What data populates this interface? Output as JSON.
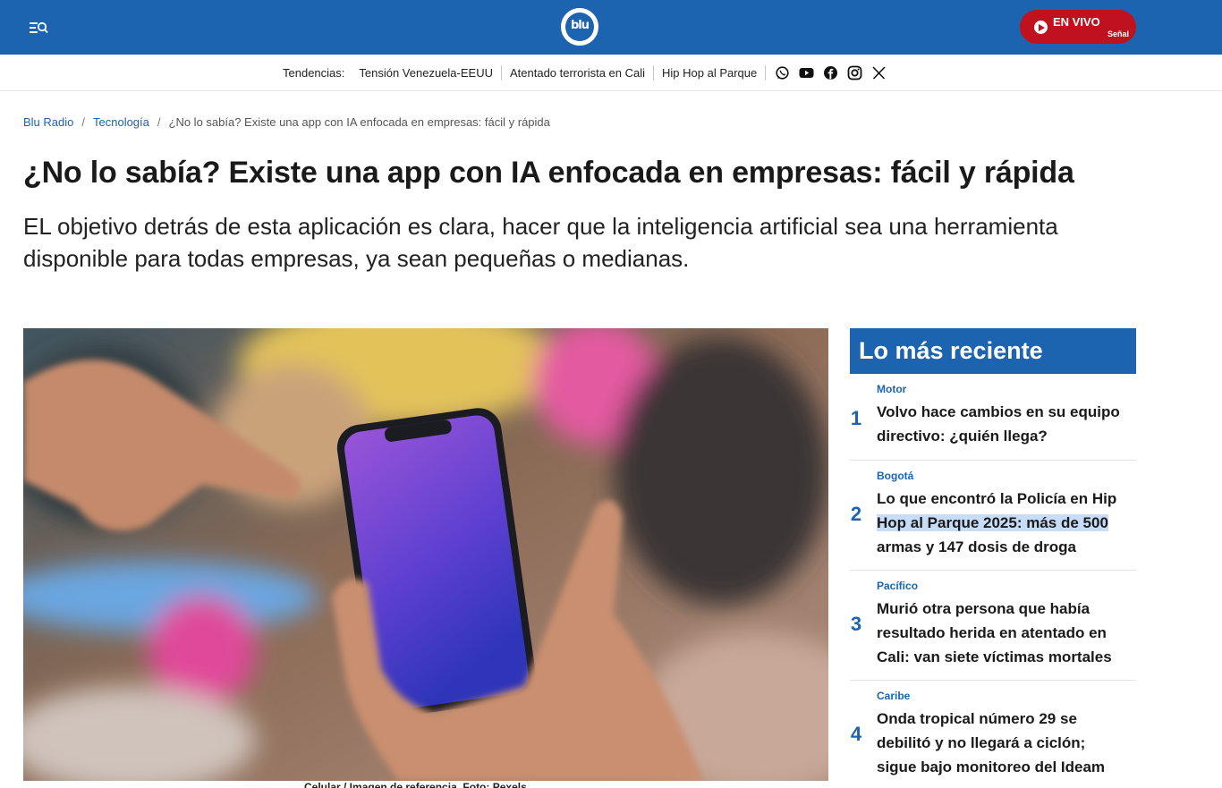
{
  "header": {
    "logo_text": "blu",
    "live_label": "EN VIVO",
    "live_sub": "Señal",
    "colors": {
      "brand": "#1c63b0",
      "live": "#c0111f"
    }
  },
  "trends": {
    "label": "Tendencias:",
    "links": [
      "Tensión Venezuela-EEUU",
      "Atentado terrorista en Cali",
      "Hip Hop al Parque"
    ],
    "social": [
      "whatsapp-icon",
      "youtube-icon",
      "facebook-icon",
      "instagram-icon",
      "x-icon"
    ]
  },
  "breadcrumb": {
    "items": [
      "Blu Radio",
      "Tecnología"
    ],
    "separator": "/",
    "current": "¿No lo sabía? Existe una app con IA enfocada en empresas: fácil y rápida"
  },
  "article": {
    "title": "¿No lo sabía? Existe una app con IA enfocada en empresas: fácil y rápida",
    "subtitle": "EL objetivo detrás de esta aplicación es clara, hacer que la inteligencia artificial sea una herramienta disponible para todas empresas, ya sean pequeñas o medianas.",
    "caption": "Celular / Imagen de referencia. Foto: Pexels"
  },
  "sidebar": {
    "title": "Lo más reciente",
    "items": [
      {
        "num": "1",
        "category": "Motor",
        "text": "Volvo hace cambios en su equipo directivo: ¿quién llega?"
      },
      {
        "num": "2",
        "category": "Bogotá",
        "text_a": "Lo que encontró la Policía en Hip ",
        "text_hl": "Hop al Parque 2025: más de 500",
        "text_b": " armas y 147 dosis de droga"
      },
      {
        "num": "3",
        "category": "Pacífico",
        "text": "Murió otra persona que había resultado herida en atentado en Cali: van siete víctimas mortales"
      },
      {
        "num": "4",
        "category": "Caribe",
        "text": "Onda tropical número 29 se debilitó y no llegará a ciclón; sigue bajo monitoreo del Ideam"
      }
    ]
  }
}
